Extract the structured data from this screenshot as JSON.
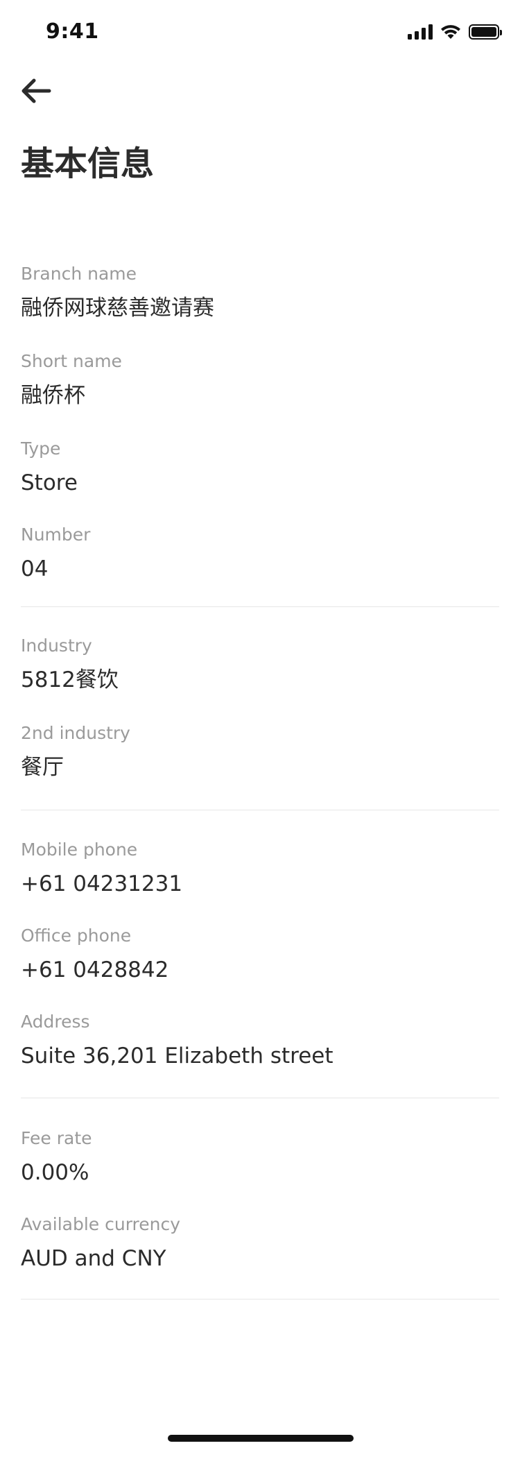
{
  "status_bar": {
    "time": "9:41",
    "icons": [
      "signal-icon",
      "wifi-icon",
      "battery-icon"
    ]
  },
  "header": {
    "back_icon": "arrow-left-icon",
    "title": "基本信息"
  },
  "sections": [
    {
      "fields": [
        {
          "label": "Branch name",
          "value": "融侨网球慈善邀请赛"
        },
        {
          "label": "Short name",
          "value": "融侨杯"
        },
        {
          "label": "Type",
          "value": "Store"
        },
        {
          "label": "Number",
          "value": "04"
        }
      ]
    },
    {
      "fields": [
        {
          "label": "Industry",
          "value": "5812餐饮"
        },
        {
          "label": "2nd industry",
          "value": "餐厅"
        }
      ]
    },
    {
      "fields": [
        {
          "label": "Mobile phone",
          "value": "+61 04231231"
        },
        {
          "label": "Office phone",
          "value": "+61 0428842"
        },
        {
          "label": "Address",
          "value": "Suite 36,201 Elizabeth street"
        }
      ]
    },
    {
      "fields": [
        {
          "label": "Fee rate",
          "value": "0.00%"
        },
        {
          "label": "Available currency",
          "value": "AUD and CNY"
        }
      ]
    }
  ],
  "colors": {
    "label": "#9a9a9a",
    "value": "#2b2b2b",
    "divider": "#e6e6e6",
    "background": "#ffffff"
  }
}
